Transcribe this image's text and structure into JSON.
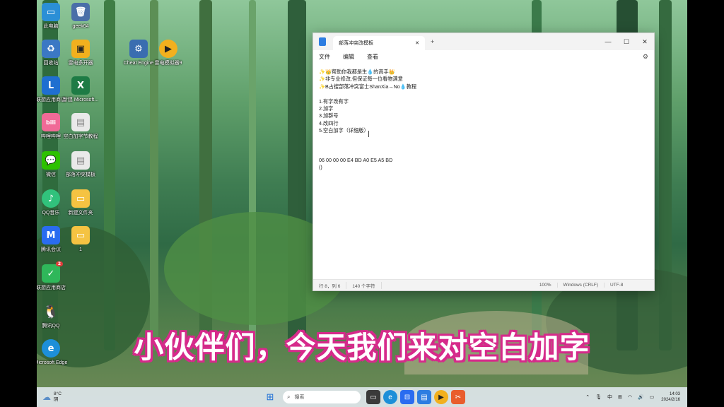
{
  "desktop": {
    "icons": [
      {
        "label": "此电脑",
        "icon": "computer-icon",
        "color": "#2b8fd6"
      },
      {
        "label": "geek64",
        "icon": "geek-icon",
        "color": "#4a6fa8"
      },
      {
        "label": "回收站",
        "icon": "recycle-bin-icon",
        "color": "#3b78c4"
      },
      {
        "label": "雷电多开器",
        "icon": "multi-instance-icon",
        "color": "#f2b01e"
      },
      {
        "label": "Cheat Engine",
        "icon": "cheat-engine-icon",
        "color": "#3a6db0"
      },
      {
        "label": "雷电模拟器9",
        "icon": "emulator-icon",
        "color": "#f2b01e"
      },
      {
        "label": "联想应用商店",
        "icon": "store-icon",
        "color": "#1f6fd0"
      },
      {
        "label": "新建 Microsoft...",
        "icon": "excel-icon",
        "color": "#1e7b45"
      },
      {
        "label": "哔哩哔哩",
        "icon": "bilibili-icon",
        "color": "#f06a97"
      },
      {
        "label": "空白加字节教程",
        "icon": "document-icon",
        "color": "#e9e9e9"
      },
      {
        "label": "微信",
        "icon": "wechat-icon",
        "color": "#2dc100"
      },
      {
        "label": "部落冲突模板",
        "icon": "document-icon",
        "color": "#e9e9e9"
      },
      {
        "label": "QQ音乐",
        "icon": "qq-music-icon",
        "color": "#31c27c"
      },
      {
        "label": "新建文件夹",
        "icon": "folder-icon",
        "color": "#f5c342"
      },
      {
        "label": "腾讯会议",
        "icon": "meeting-icon",
        "color": "#2a6cf0"
      },
      {
        "label": "1",
        "icon": "folder-icon",
        "color": "#f5c342"
      },
      {
        "label": "联想应用商店",
        "icon": "app-store-icon",
        "color": "#2fb75a",
        "badge": "2"
      },
      {
        "label": "腾讯QQ",
        "icon": "qq-icon",
        "color": "#1a1a1a"
      },
      {
        "label": "Microsoft Edge",
        "icon": "edge-icon",
        "color": "#1d8fd8"
      }
    ]
  },
  "notepad": {
    "tab_title": "部落冲突改模板",
    "menu": [
      "文件",
      "编辑",
      "查看"
    ],
    "lines": [
      "✨👑帮助你我都是生💧的高手👑",
      "✨非专业修改,但保证每一位看物满意",
      "✨B占搜部落冲突富士ShanXia→No💧教程",
      "",
      "1.有字改有字",
      "2.加字",
      "3.加群号",
      "4.改四行",
      "5.空白加字（详细版）",
      "",
      "",
      "",
      "06 00 00 00 E4 BD A0 E5 A5 BD",
      "()"
    ],
    "status": {
      "position": "行 8，列 6",
      "chars": "140 个字符",
      "zoom": "100%",
      "line_ending": "Windows (CRLF)",
      "encoding": "UTF-8"
    }
  },
  "subtitle": "小伙伴们，今天我们来对空白加字",
  "taskbar": {
    "weather_temp": "8°C",
    "weather_desc": "阴",
    "search_placeholder": "搜索",
    "tray_lang": "中",
    "time": "14:03",
    "date": "2024/2/16"
  }
}
